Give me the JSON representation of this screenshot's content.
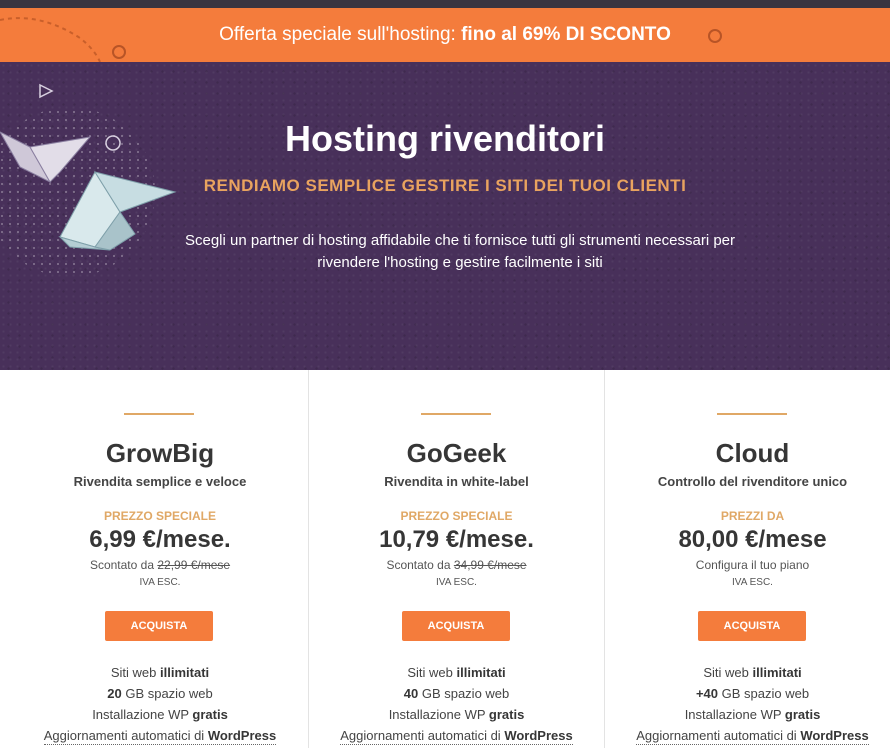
{
  "promo": {
    "text": "Offerta speciale sull'hosting:",
    "highlight": "fino al 69% DI SCONTO"
  },
  "hero": {
    "title": "Hosting rivenditori",
    "subtitle": "RENDIAMO SEMPLICE GESTIRE I SITI DEI TUOI CLIENTI",
    "description_line1": "Scegli un partner di hosting affidabile che ti fornisce tutti gli strumenti necessari per",
    "description_line2": "rivendere l'hosting e gestire facilmente i siti"
  },
  "colors": {
    "accent": "#f47c3c",
    "hero_bg": "#48305a",
    "gold": "#e0a866"
  },
  "plans": [
    {
      "name": "GrowBig",
      "tagline": "Rivendita semplice e veloce",
      "price_label": "PREZZO SPECIALE",
      "price": "6,99 €/mese.",
      "discount_prefix": "Scontato da",
      "old_price": "22,99 €/mese",
      "vat": "IVA ESC.",
      "button": "ACQUISTA",
      "f1_pre": "Siti web",
      "f1_bold": "illimitati",
      "f2_bold": "20",
      "f2_post": "GB spazio web",
      "f3_pre": "Installazione WP",
      "f3_bold": "gratis",
      "f4_pre": "Aggiornamenti automatici di",
      "f4_bold": "WordPress"
    },
    {
      "name": "GoGeek",
      "tagline": "Rivendita in white-label",
      "price_label": "PREZZO SPECIALE",
      "price": "10,79 €/mese.",
      "discount_prefix": "Scontato da",
      "old_price": "34,99 €/mese",
      "vat": "IVA ESC.",
      "button": "ACQUISTA",
      "f1_pre": "Siti web",
      "f1_bold": "illimitati",
      "f2_bold": "40",
      "f2_post": "GB spazio web",
      "f3_pre": "Installazione WP",
      "f3_bold": "gratis",
      "f4_pre": "Aggiornamenti automatici di",
      "f4_bold": "WordPress"
    },
    {
      "name": "Cloud",
      "tagline": "Controllo del rivenditore unico",
      "price_label": "PREZZI DA",
      "price": "80,00 €/mese",
      "config": "Configura il tuo piano",
      "vat": "IVA ESC.",
      "button": "ACQUISTA",
      "f1_pre": "Siti web",
      "f1_bold": "illimitati",
      "f2_bold": "+40",
      "f2_post": "GB spazio web",
      "f3_pre": "Installazione WP",
      "f3_bold": "gratis",
      "f4_pre": "Aggiornamenti automatici di",
      "f4_bold": "WordPress"
    }
  ]
}
